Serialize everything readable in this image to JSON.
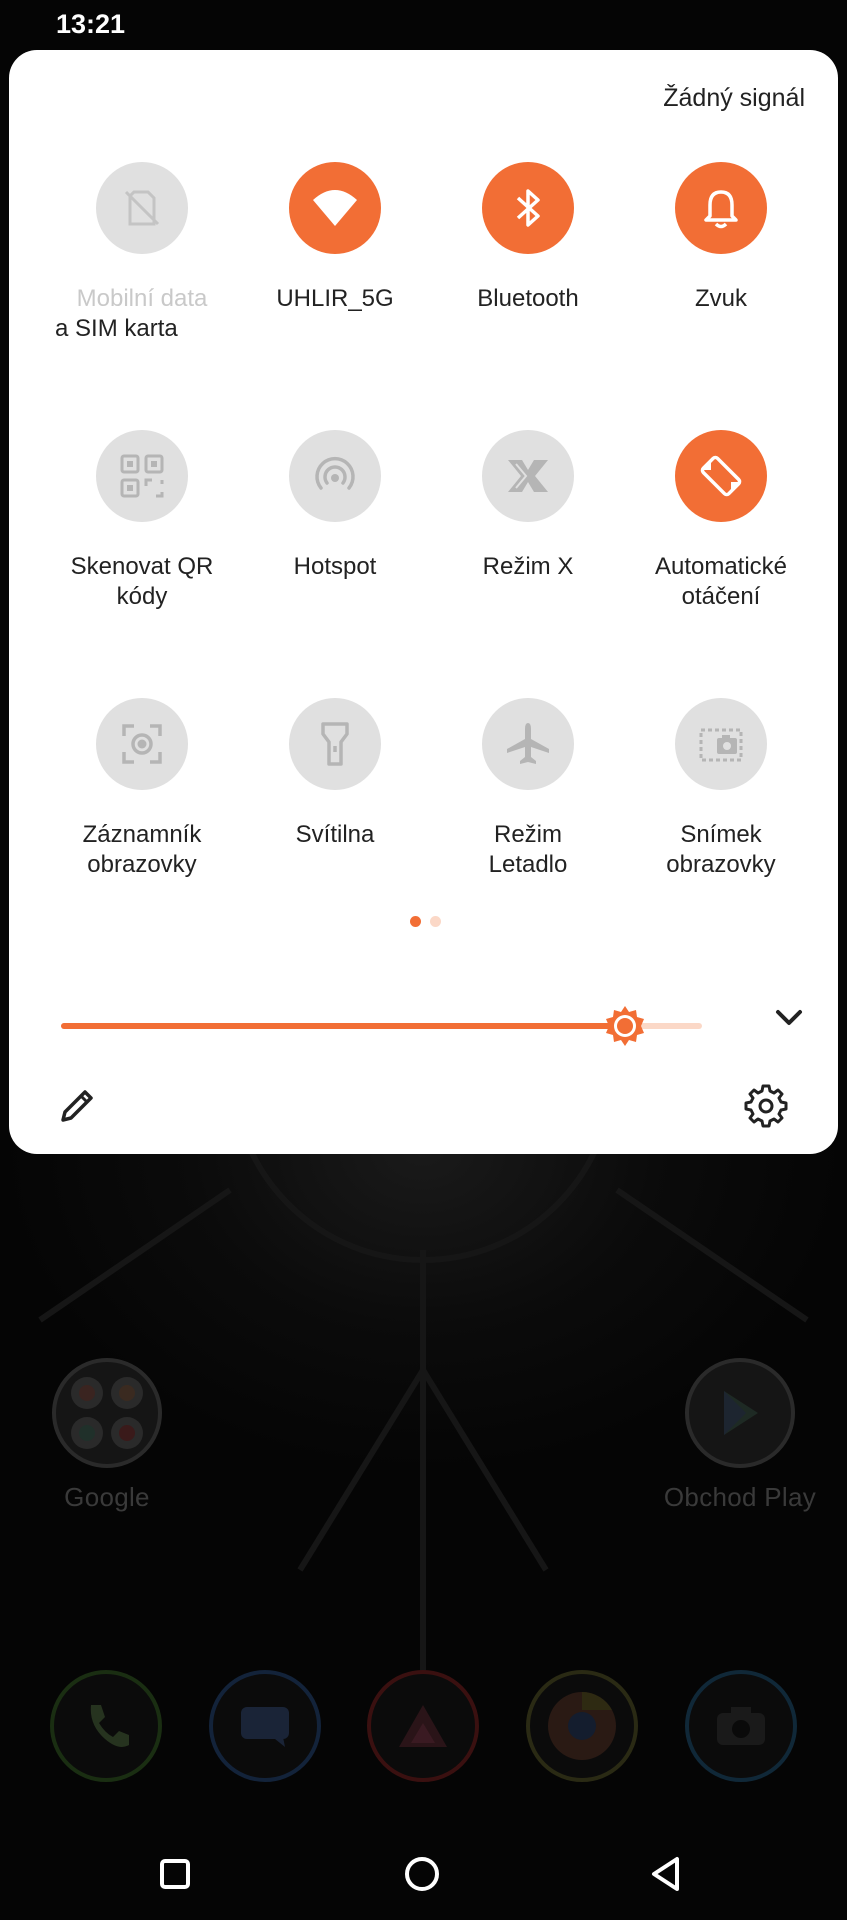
{
  "status_bar": {
    "time": "13:21"
  },
  "panel": {
    "network_status": "Žádný signál",
    "tiles": [
      {
        "name": "mobile-data",
        "label": "Mobilní data",
        "sublabel": "a SIM karta",
        "icon": "no-sim-icon",
        "state": "unavailable"
      },
      {
        "name": "wifi",
        "label": "UHLIR_5G",
        "icon": "wifi-icon",
        "state": "on"
      },
      {
        "name": "bluetooth",
        "label": "Bluetooth",
        "icon": "bluetooth-icon",
        "state": "on"
      },
      {
        "name": "sound",
        "label": "Zvuk",
        "icon": "bell-icon",
        "state": "on"
      },
      {
        "name": "qr-scan",
        "label_line1": "Skenovat QR",
        "label_line2": "kódy",
        "icon": "qr-code-icon",
        "state": "off"
      },
      {
        "name": "hotspot",
        "label": "Hotspot",
        "icon": "hotspot-icon",
        "state": "off"
      },
      {
        "name": "x-mode",
        "label": "Režim X",
        "icon": "x-mode-icon",
        "state": "off"
      },
      {
        "name": "auto-rotate",
        "label_line1": "Automatické",
        "label_line2": "otáčení",
        "icon": "rotate-icon",
        "state": "on"
      },
      {
        "name": "screen-recorder",
        "label_line1": "Záznamník",
        "label_line2": "obrazovky",
        "icon": "screen-record-icon",
        "state": "off"
      },
      {
        "name": "flashlight",
        "label": "Svítilna",
        "icon": "flashlight-icon",
        "state": "off"
      },
      {
        "name": "airplane",
        "label_line1": "Režim",
        "label_line2": "Letadlo",
        "icon": "airplane-icon",
        "state": "off"
      },
      {
        "name": "screenshot",
        "label_line1": "Snímek",
        "label_line2": "obrazovky",
        "icon": "screenshot-icon",
        "state": "off"
      }
    ],
    "page_count": 2,
    "current_page": 1,
    "brightness_level": 0.88
  },
  "home": {
    "apps": [
      {
        "name": "google-folder",
        "label": "Google"
      },
      {
        "name": "play-store",
        "label": "Obchod Play"
      }
    ],
    "dock": [
      "phone",
      "messages",
      "asus-app",
      "chrome",
      "camera"
    ]
  },
  "nav": {
    "buttons": [
      "recents",
      "home",
      "back"
    ]
  },
  "colors": {
    "accent": "#f26e35",
    "accent_light": "#fbd8c7",
    "tile_off": "#e0e0e0",
    "icon_off": "#bdbdbd",
    "text": "#222222",
    "text_disabled": "#c9c9c9",
    "panel_bg": "#ffffff"
  }
}
